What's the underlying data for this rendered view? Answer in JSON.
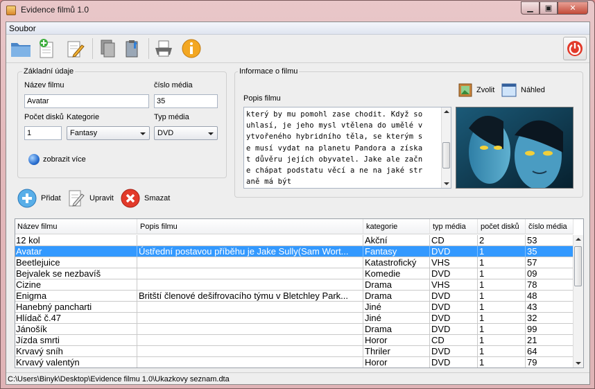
{
  "window": {
    "title": "Evidence filmů 1.0"
  },
  "menu": {
    "file": "Soubor"
  },
  "toolbar": {
    "icons": [
      "open-folder-icon",
      "new-document-icon",
      "edit-icon",
      "copy-icon",
      "paste-icon",
      "print-icon",
      "info-icon",
      "power-icon"
    ]
  },
  "basic": {
    "group_title": "Základní údaje",
    "title_label": "Název filmu",
    "title_value": "Avatar",
    "media_no_label": "číslo média",
    "media_no_value": "35",
    "discs_label": "Počet disků",
    "discs_value": "1",
    "category_label": "Kategorie",
    "category_value": "Fantasy",
    "media_type_label": "Typ média",
    "media_type_value": "DVD",
    "show_more": "zobrazit více"
  },
  "info": {
    "group_title": "Informace o filmu",
    "desc_label": "Popis filmu",
    "choose_label": "Zvolit",
    "preview_label": "Náhled",
    "desc_lines": [
      "který by mu pomohl zase chodit. Když so",
      "uhlasí, je jeho mysl vtělena do umělé v",
      "ytvořeného hybridního těla, se kterým s",
      "e musí vydat na planetu Pandora a získa",
      "t důvěru jejích obyvatel. Jake ale začn",
      "e chápat podstatu věcí a ne na jaké str",
      "aně má být"
    ]
  },
  "actions": {
    "add": "Přidat",
    "edit": "Upravit",
    "delete": "Smazat"
  },
  "table": {
    "columns": [
      "Název filmu",
      "Popis filmu",
      "kategorie",
      "typ média",
      "počet disků",
      "číslo média"
    ],
    "rows": [
      [
        "12 kol",
        "",
        "Akční",
        "CD",
        "2",
        "53"
      ],
      [
        "Avatar",
        "Ústřední postavou příběhu je Jake Sully(Sam Wort...",
        "Fantasy",
        "DVD",
        "1",
        "35"
      ],
      [
        "Beetlejuice",
        "",
        "Katastrofický",
        "VHS",
        "1",
        "57"
      ],
      [
        "Bejvalek se nezbavíš",
        "",
        "Komedie",
        "DVD",
        "1",
        "09"
      ],
      [
        "Cizine",
        "",
        "Drama",
        "VHS",
        "1",
        "78"
      ],
      [
        "Enigma",
        "Britští členové dešifrovacího týmu v Bletchley Park...",
        "Drama",
        "DVD",
        "1",
        "48"
      ],
      [
        "Hanebný pancharti",
        "",
        "Jiné",
        "DVD",
        "1",
        "43"
      ],
      [
        "Hlídač č.47",
        "",
        "Jiné",
        "DVD",
        "1",
        "32"
      ],
      [
        "Jánošík",
        "",
        "Drama",
        "DVD",
        "1",
        "99"
      ],
      [
        "Jízda smrti",
        "",
        "Horor",
        "CD",
        "1",
        "21"
      ],
      [
        "Krvavý sníh",
        "",
        "Thriler",
        "DVD",
        "1",
        "64"
      ],
      [
        "Krvavý valentýn",
        "",
        "Horor",
        "DVD",
        "1",
        "79"
      ]
    ],
    "selected_index": 1
  },
  "status": {
    "path": "C:\\Users\\Binyk\\Desktop\\Evidence filmu 1.0\\Ukazkovy seznam.dta"
  },
  "colors": {
    "selection": "#3399ff",
    "window_frame": "#e3b8ba"
  }
}
